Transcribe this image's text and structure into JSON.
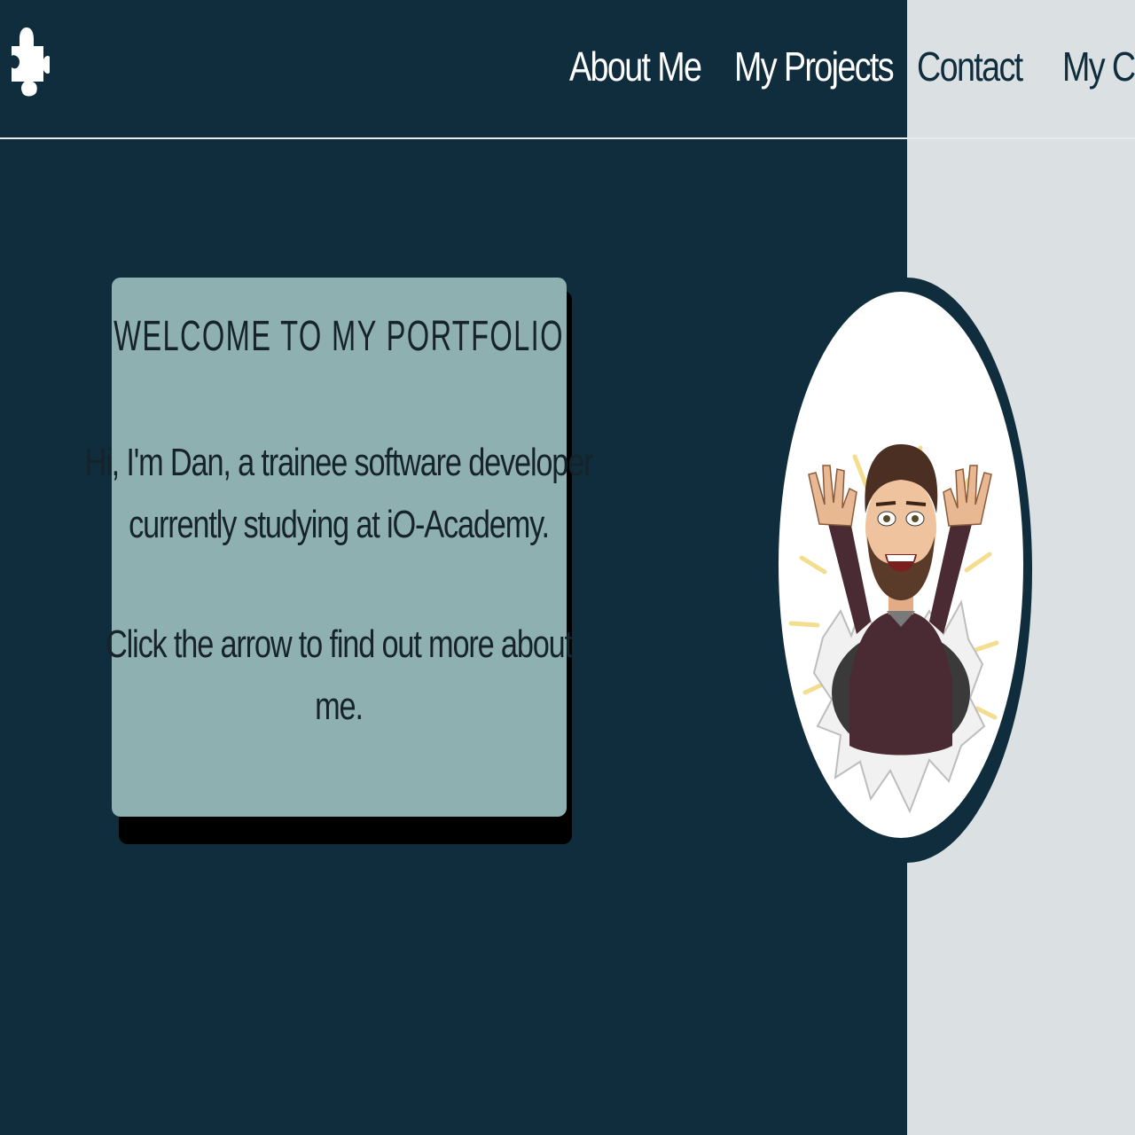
{
  "nav": {
    "logo_icon": "puzzle-piece-icon",
    "links": [
      "About Me",
      "My Projects",
      "Contact",
      "My CV"
    ]
  },
  "colors": {
    "background": "#0f2d3c",
    "right_panel": "#dbe1e2",
    "card": "#8fb0b1",
    "card_shadow": "#000000",
    "text_dark": "#16232b"
  },
  "hero": {
    "title": "WELCOME TO MY PORTFOLIO",
    "intro_line1": "Hi, I'm Dan, a trainee software developer",
    "intro_line2": "currently studying at iO-Academy.",
    "cta_line1": "Click the arrow to find out more about",
    "cta_line2": "me.",
    "avatar": "bitmoji-avatar"
  }
}
